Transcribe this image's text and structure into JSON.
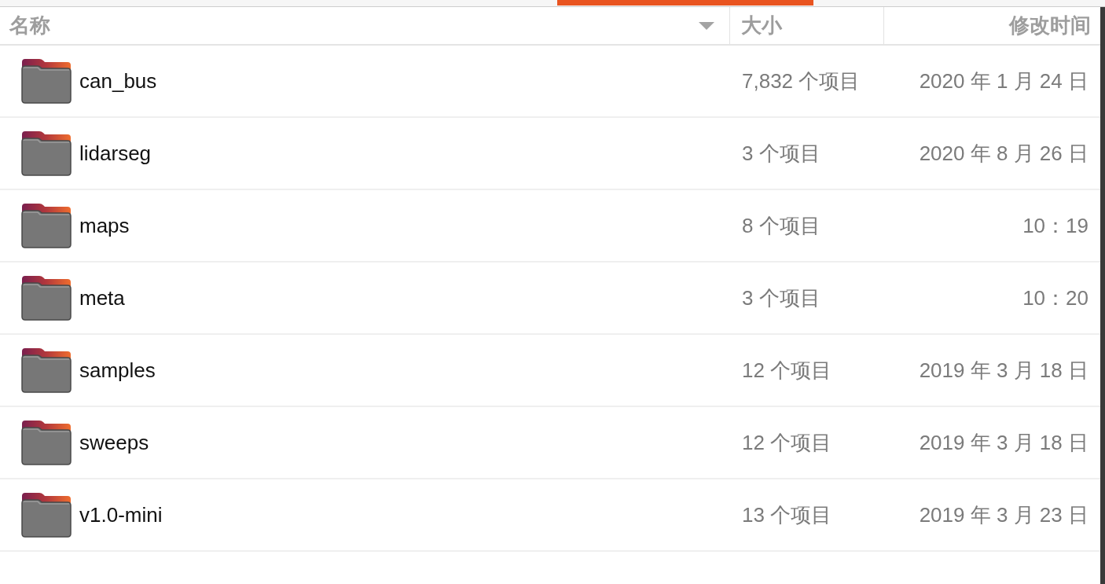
{
  "columns": [
    {
      "label": "名称",
      "sorted": true
    },
    {
      "label": "大小",
      "sorted": false
    },
    {
      "label": "修改时间",
      "sorted": false
    }
  ],
  "rows": [
    {
      "name": "can_bus",
      "size": "7,832 个项目",
      "modified": "2020 年 1 月 24 日"
    },
    {
      "name": "lidarseg",
      "size": "3 个项目",
      "modified": "2020 年 8 月 26 日"
    },
    {
      "name": "maps",
      "size": "8 个项目",
      "modified": "10：19"
    },
    {
      "name": "meta",
      "size": "3 个项目",
      "modified": "10：20"
    },
    {
      "name": "samples",
      "size": "12 个项目",
      "modified": "2019 年 3 月 18 日"
    },
    {
      "name": "sweeps",
      "size": "12 个项目",
      "modified": "2019 年 3 月 18 日"
    },
    {
      "name": "v1.0-mini",
      "size": "13 个项目",
      "modified": "2019 年 3 月 23 日"
    }
  ]
}
